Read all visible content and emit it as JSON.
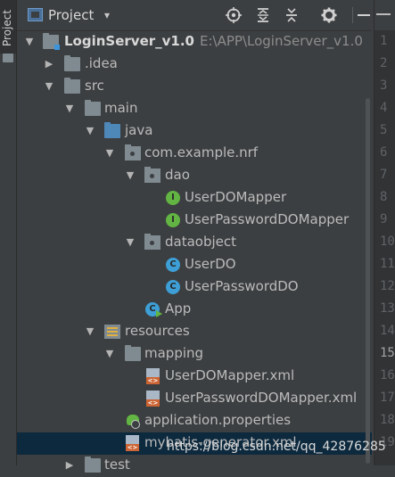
{
  "side_tab": {
    "label": "Project"
  },
  "toolbar": {
    "title": "Project",
    "dropdown_glyph": "▾",
    "icons": [
      "locate-icon",
      "expand-all-icon",
      "collapse-all-icon",
      "gear-icon",
      "hide-icon"
    ]
  },
  "tree": {
    "items": [
      {
        "label": "LoginServer_v1.0",
        "path": "E:\\APP\\LoginServer_v1.0",
        "icon": "module-folder",
        "expanded": true
      },
      {
        "label": ".idea",
        "icon": "folder",
        "expanded": false
      },
      {
        "label": "src",
        "icon": "folder",
        "expanded": true
      },
      {
        "label": "main",
        "icon": "folder",
        "expanded": true
      },
      {
        "label": "java",
        "icon": "source-folder",
        "expanded": true
      },
      {
        "label": "com.example.nrf",
        "icon": "package",
        "expanded": true
      },
      {
        "label": "dao",
        "icon": "package",
        "expanded": true
      },
      {
        "label": "UserDOMapper",
        "icon": "interface",
        "badge": "I"
      },
      {
        "label": "UserPasswordDOMapper",
        "icon": "interface",
        "badge": "I"
      },
      {
        "label": "dataobject",
        "icon": "package",
        "expanded": true
      },
      {
        "label": "UserDO",
        "icon": "class",
        "badge": "C"
      },
      {
        "label": "UserPasswordDO",
        "icon": "class",
        "badge": "C"
      },
      {
        "label": "App",
        "icon": "spring-app",
        "badge": "C"
      },
      {
        "label": "resources",
        "icon": "resources-folder",
        "expanded": true
      },
      {
        "label": "mapping",
        "icon": "folder",
        "expanded": true
      },
      {
        "label": "UserDOMapper.xml",
        "icon": "xml-file"
      },
      {
        "label": "UserPasswordDOMapper.xml",
        "icon": "xml-file"
      },
      {
        "label": "application.properties",
        "icon": "properties-file"
      },
      {
        "label": "mybatis-generator.xml",
        "icon": "xml-file",
        "selected": true
      },
      {
        "label": "test",
        "icon": "folder",
        "expanded": false
      }
    ]
  },
  "gutter": {
    "line_numbers": [
      "1",
      "2",
      "3",
      "4",
      "5",
      "6",
      "7",
      "8",
      "9",
      "10",
      "11",
      "12",
      "13",
      "14",
      "15",
      "16",
      "17",
      "18",
      "19"
    ],
    "active_line": "15"
  },
  "watermark": "https://blog.csdn.net/qq_42876285",
  "colors": {
    "panel_bg": "#3c3f41",
    "selection_bg": "#0d293e",
    "interface_badge": "#62b543",
    "class_badge": "#3d9fd6",
    "xml_badge": "#cc6433"
  }
}
